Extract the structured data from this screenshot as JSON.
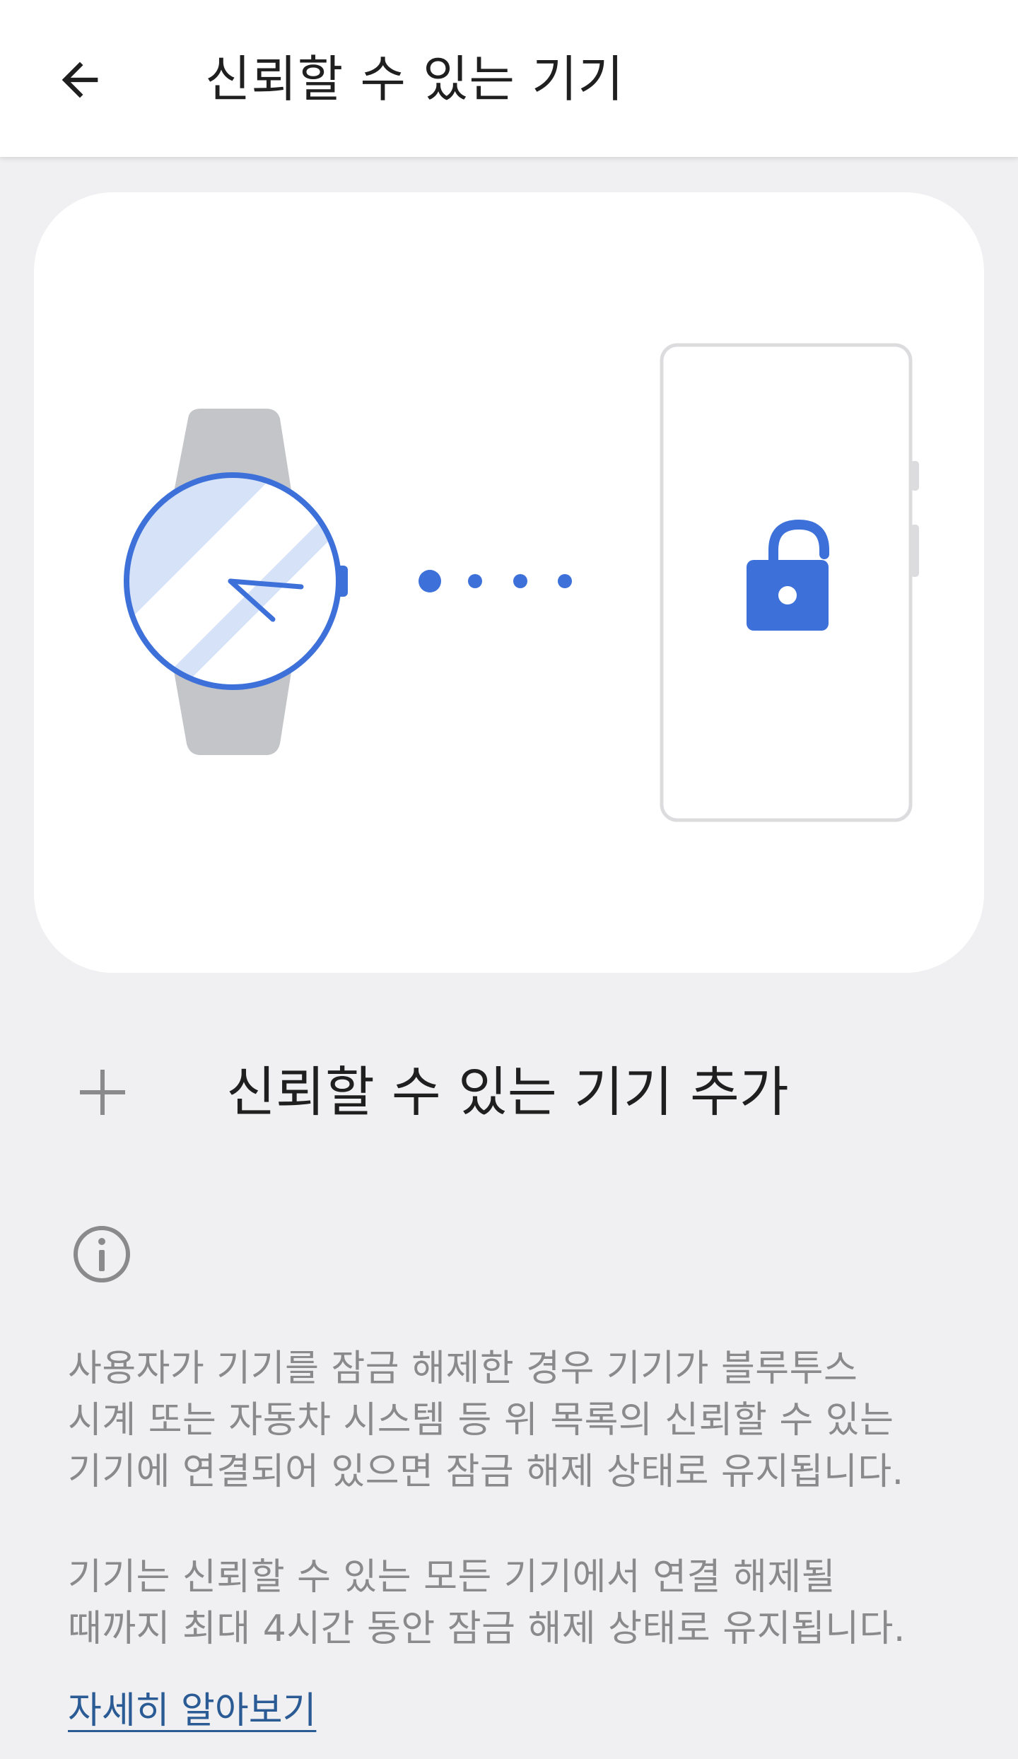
{
  "appbar": {
    "title": "신뢰할 수 있는 기기",
    "back_icon": "arrow-back-icon"
  },
  "illustration": {
    "watch_icon": "smartwatch-icon",
    "phone_icon": "phone-icon",
    "lock_icon": "unlocked-padlock-icon",
    "colors": {
      "accent": "#3d71d9",
      "accent_light": "#d5e2f8",
      "band": "#c3c5c9",
      "phone_outline": "#dcdcdf"
    }
  },
  "add_device": {
    "icon": "plus-icon",
    "label": "신뢰할 수 있는 기기 추가"
  },
  "info": {
    "icon": "info-icon",
    "paragraph1": [
      "사용자가 기기를 잠금 해제한 경우 기기가 블루투스",
      "시계 또는 자동차 시스템 등 위 목록의 신뢰할 수 있는",
      "기기에 연결되어 있으면 잠금 해제 상태로 유지됩니다."
    ],
    "paragraph2": [
      "기기는 신뢰할 수 있는 모든 기기에서 연결 해제될",
      "때까지 최대 4시간 동안 잠금 해제 상태로 유지됩니다."
    ],
    "learn_more": "자세히 알아보기"
  }
}
